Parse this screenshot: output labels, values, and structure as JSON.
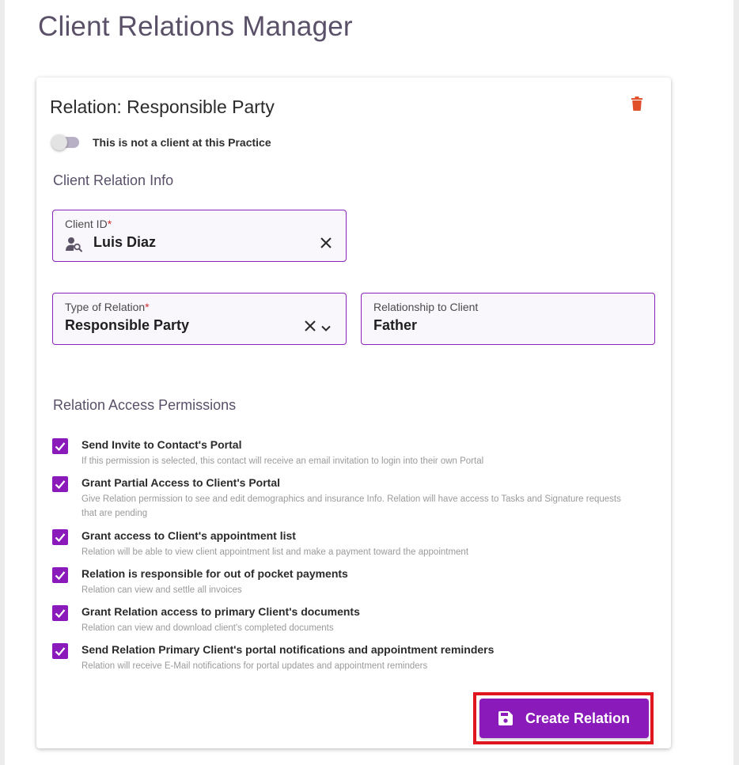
{
  "page": {
    "title": "Client Relations Manager"
  },
  "card": {
    "title": "Relation: Responsible Party",
    "toggle": {
      "label": "This is not a client at this Practice",
      "on": false
    },
    "info_section": "Client Relation Info",
    "client_id": {
      "label": "Client ID",
      "required": "*",
      "value": "Luis Diaz",
      "icon": "person-search-icon"
    },
    "type_of_relation": {
      "label": "Type of Relation",
      "required": "*",
      "value": "Responsible Party"
    },
    "relationship": {
      "label": "Relationship to Client",
      "value": "Father"
    },
    "permissions_section": "Relation Access Permissions",
    "permissions": [
      {
        "title": "Send Invite to Contact's Portal",
        "desc": "If this permission is selected, this contact will receive an email invitation to login into their own Portal",
        "checked": true
      },
      {
        "title": "Grant Partial Access to Client's Portal",
        "desc": "Give Relation permission to see and edit demographics and insurance Info. Relation will have access to Tasks and Signature requests that are pending",
        "checked": true
      },
      {
        "title": "Grant access to Client's appointment list",
        "desc": "Relation will be able to view client appointment list and make a payment toward the appointment",
        "checked": true
      },
      {
        "title": "Relation is responsible for out of pocket payments",
        "desc": "Relation can view and settle all invoices",
        "checked": true
      },
      {
        "title": "Grant Relation access to primary Client's documents",
        "desc": "Relation can view and download client's completed documents",
        "checked": true
      },
      {
        "title": "Send Relation Primary Client's portal notifications and appointment reminders",
        "desc": "Relation will receive E-Mail notifications for portal updates and appointment reminders",
        "checked": true
      }
    ],
    "create_button": {
      "label": "Create Relation",
      "icon": "save-icon"
    }
  },
  "colors": {
    "accent": "#8a1ab9",
    "danger": "#e0161e",
    "title": "#5a5068"
  }
}
